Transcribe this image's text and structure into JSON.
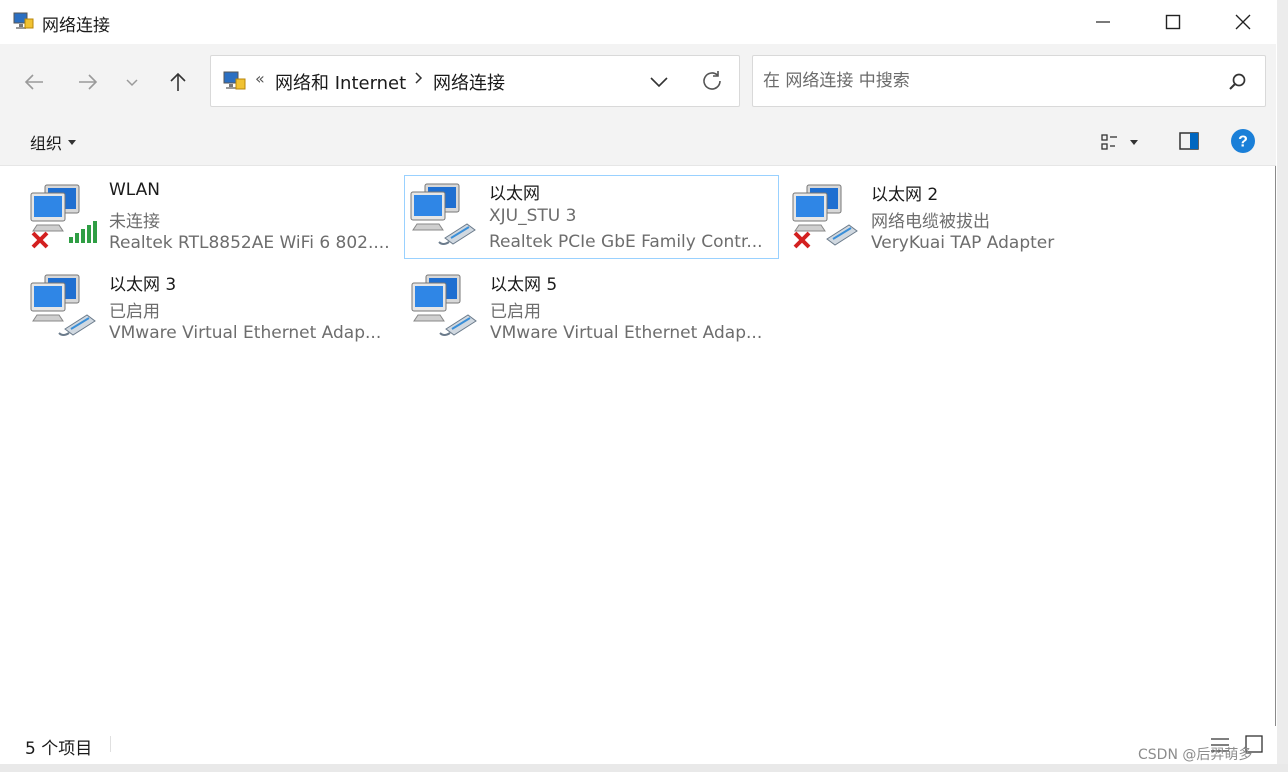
{
  "window": {
    "title": "网络连接",
    "minimize_icon": "minimize-icon",
    "maximize_icon": "maximize-icon",
    "close_icon": "close-icon"
  },
  "nav": {
    "back_icon": "arrow-left-icon",
    "forward_icon": "arrow-right-icon",
    "recent_icon": "chevron-down-icon",
    "up_icon": "arrow-up-icon"
  },
  "address": {
    "overflow_chevron": "«",
    "crumbs": [
      "网络和 Internet",
      "网络连接"
    ],
    "dropdown_icon": "chevron-down-icon",
    "refresh_icon": "refresh-icon"
  },
  "search": {
    "placeholder": "在 网络连接 中搜索",
    "value": ""
  },
  "command_bar": {
    "organize_label": "组织",
    "view_icon": "change-view-icon",
    "preview_pane_icon": "preview-pane-icon",
    "help_icon": "help-icon"
  },
  "connections": [
    {
      "name": "WLAN",
      "status": "未连接",
      "adapter": "Realtek RTL8852AE WiFi 6 802....",
      "type": "wireless",
      "disconnected": true,
      "selected": false
    },
    {
      "name": "以太网",
      "status": "XJU_STU 3",
      "adapter": "Realtek PCIe GbE Family Contr...",
      "type": "ethernet",
      "disconnected": false,
      "selected": true
    },
    {
      "name": "以太网 2",
      "status": "网络电缆被拔出",
      "adapter": "VeryKuai TAP Adapter",
      "type": "ethernet",
      "disconnected": true,
      "selected": false
    },
    {
      "name": "以太网 3",
      "status": "已启用",
      "adapter": "VMware Virtual Ethernet Adap...",
      "type": "ethernet",
      "disconnected": false,
      "selected": false
    },
    {
      "name": "以太网 5",
      "status": "已启用",
      "adapter": "VMware Virtual Ethernet Adap...",
      "type": "ethernet",
      "disconnected": false,
      "selected": false
    }
  ],
  "status_bar": {
    "item_count": "5 个项目"
  },
  "watermark": "CSDN @后羿萌多",
  "colors": {
    "accent": "#0067c0",
    "selection_border": "#99d1ff",
    "chrome_bg": "#f3f3f3",
    "error_red": "#d32020",
    "signal_green": "#2f9e44"
  }
}
